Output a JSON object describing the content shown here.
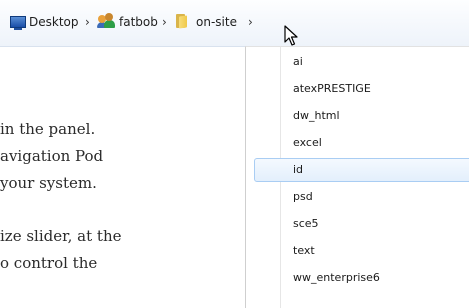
{
  "breadcrumb": {
    "items": [
      {
        "label": "Desktop",
        "icon": "desktop-icon"
      },
      {
        "label": "fatbob",
        "icon": "user-folder-icon"
      },
      {
        "label": "on-site",
        "icon": "folder-icon"
      }
    ],
    "separator": "›"
  },
  "document": {
    "lines": [
      "in the panel.",
      "avigation Pod",
      "your system.",
      "ize slider, at the",
      "o control the"
    ]
  },
  "dropdown": {
    "items": [
      {
        "label": "ai"
      },
      {
        "label": "atexPRESTIGE"
      },
      {
        "label": "dw_html"
      },
      {
        "label": "excel"
      },
      {
        "label": "id"
      },
      {
        "label": "psd"
      },
      {
        "label": "sce5"
      },
      {
        "label": "text"
      },
      {
        "label": "ww_enterprise6"
      }
    ],
    "selected": "id"
  },
  "colors": {
    "selection_border": "#a9cdf3",
    "selection_fill": "#e3effc",
    "breadcrumb_bg": "#eef3fa"
  }
}
